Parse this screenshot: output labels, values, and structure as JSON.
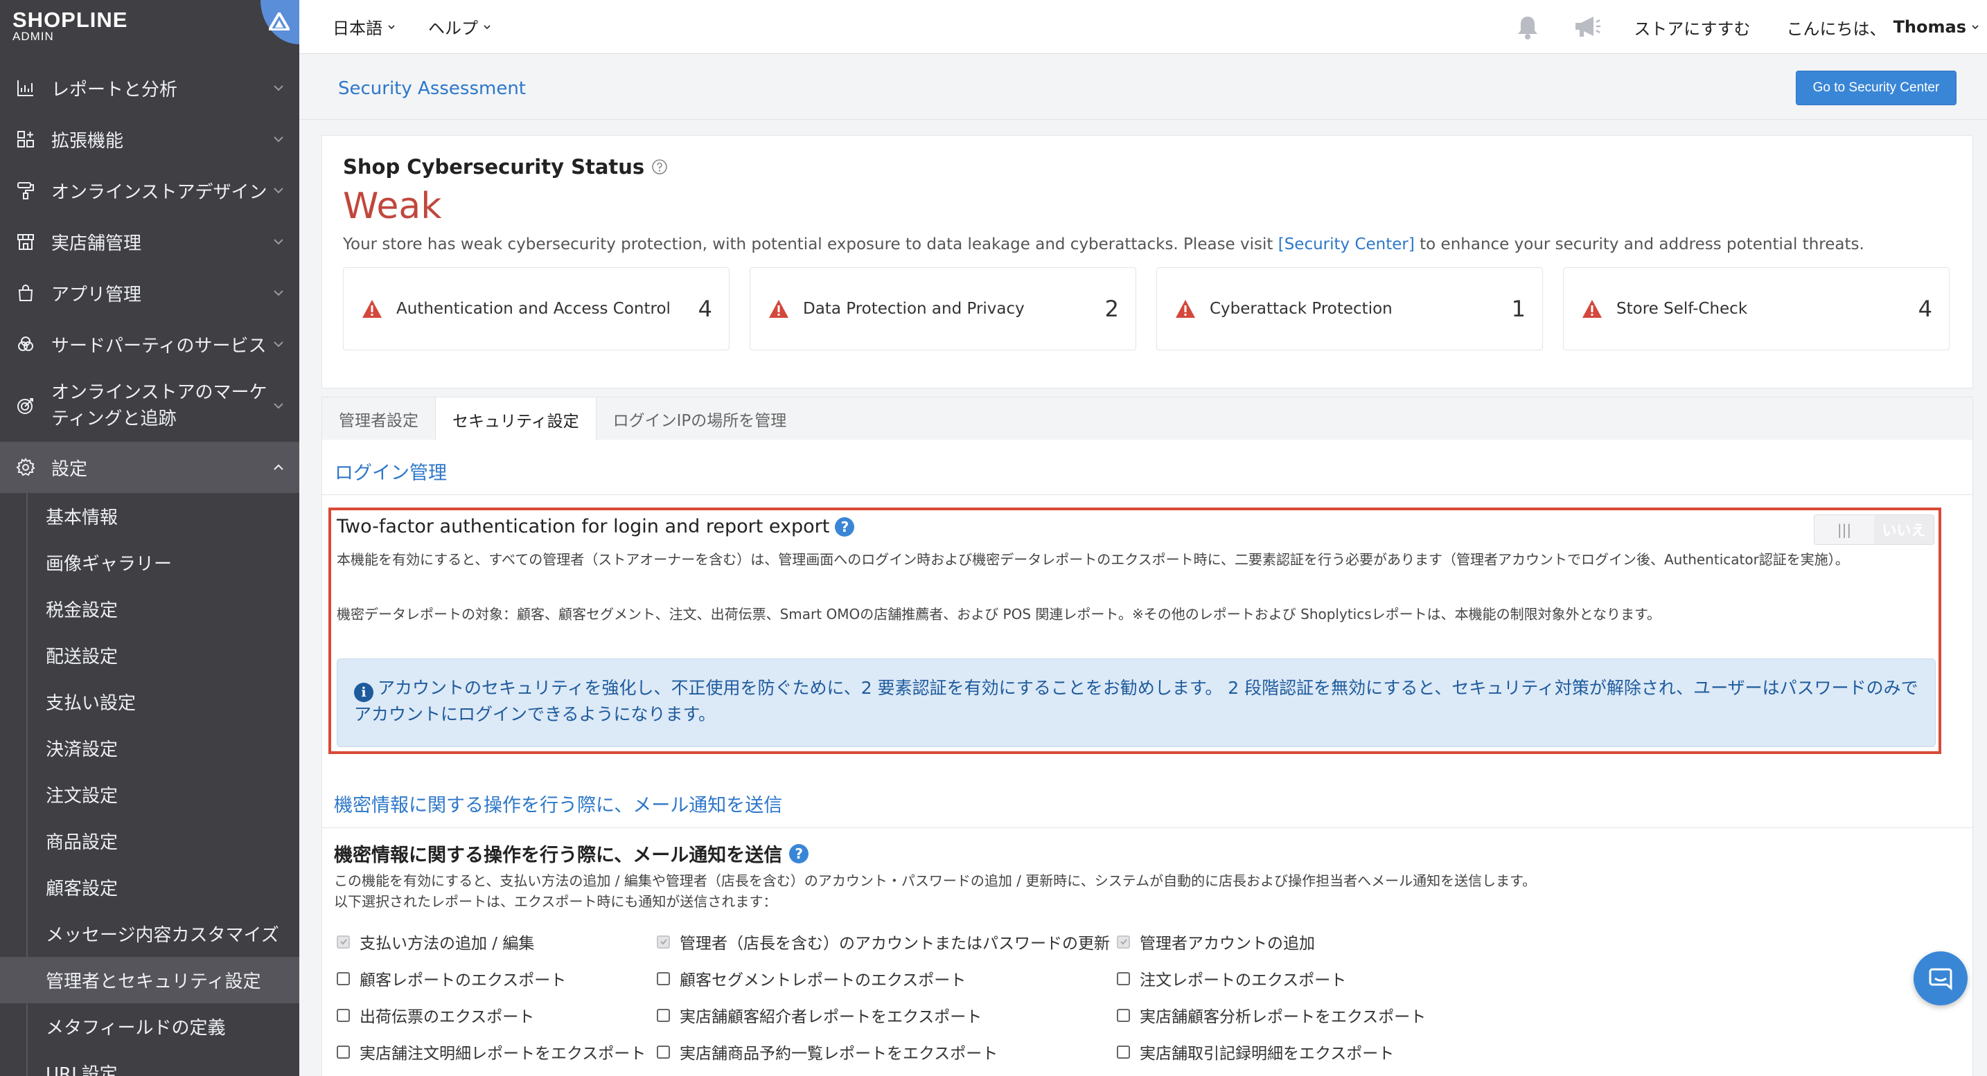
{
  "brand": {
    "name": "SHOPLINE",
    "sub": "ADMIN"
  },
  "sidebar": {
    "items": [
      {
        "label": "レポートと分析",
        "icon": "chart-icon"
      },
      {
        "label": "拡張機能",
        "icon": "grid-plus-icon"
      },
      {
        "label": "オンラインストアデザイン",
        "icon": "paint-roller-icon"
      },
      {
        "label": "実店舗管理",
        "icon": "store-icon"
      },
      {
        "label": "アプリ管理",
        "icon": "bag-icon"
      },
      {
        "label": "サードパーティのサービス",
        "icon": "circles-icon"
      },
      {
        "label": "オンラインストアのマーケティングと追跡",
        "line1": "オンラインストアのマーケ",
        "line2": "ティングと追跡",
        "icon": "target-icon"
      },
      {
        "label": "設定",
        "icon": "gear-icon"
      }
    ],
    "settings_sub": [
      "基本情報",
      "画像ギャラリー",
      "税金設定",
      "配送設定",
      "支払い設定",
      "決済設定",
      "注文設定",
      "商品設定",
      "顧客設定",
      "メッセージ内容カスタマイズ",
      "管理者とセキュリティ設定",
      "メタフィールドの定義",
      "URL設定"
    ],
    "current_sub": "管理者とセキュリティ設定"
  },
  "topbar": {
    "language": "日本語",
    "help": "ヘルプ",
    "store_link": "ストアにすすむ",
    "greeting": "こんにちは、",
    "user": "Thomas"
  },
  "page": {
    "title": "Security Assessment",
    "security_center_button": "Go to Security Center"
  },
  "status": {
    "title": "Shop Cybersecurity Status",
    "level": "Weak",
    "desc_prefix": "Your store has weak cybersecurity protection, with potential exposure to data leakage and cyberattacks. Please visit ",
    "desc_link": "[Security Center]",
    "desc_suffix": " to enhance your security and address potential threats.",
    "risks": [
      {
        "label": "Authentication and Access Control",
        "count": "4"
      },
      {
        "label": "Data Protection and Privacy",
        "count": "2"
      },
      {
        "label": "Cyberattack Protection",
        "count": "1"
      },
      {
        "label": "Store Self-Check",
        "count": "4"
      }
    ]
  },
  "tabs": [
    {
      "label": "管理者設定",
      "active": false
    },
    {
      "label": "セキュリティ設定",
      "active": true
    },
    {
      "label": "ログインIPの場所を管理",
      "active": false
    }
  ],
  "login_section": {
    "title": "ログイン管理"
  },
  "tfa": {
    "title": "Two-factor authentication for login and report export",
    "desc1": "本機能を有効にすると、すべての管理者（ストアオーナーを含む）は、管理画面へのログイン時および機密データレポートのエクスポート時に、二要素認証を行う必要があります（管理者アカウントでログイン後、Authenticator認証を実施）。",
    "desc2": "機密データレポートの対象：顧客、顧客セグメント、注文、出荷伝票、Smart OMOの店舗推薦者、および POS 関連レポート。※その他のレポートおよび Shoplyticsレポートは、本機能の制限対象外となります。",
    "toggle_on_glyph": "|||",
    "toggle_off_label": "いいえ",
    "toggle_state": "off",
    "info": "アカウントのセキュリティを強化し、不正使用を防ぐために、2 要素認証を有効にすることをお勧めします。 2 段階認証を無効にすると、セキュリティ対策が解除され、ユーザーはパスワードのみでアカウントにログインできるようになります。"
  },
  "mail_section": {
    "heading": "機密情報に関する操作を行う際に、メール通知を送信",
    "title": "機密情報に関する操作を行う際に、メール通知を送信",
    "desc1": "この機能を有効にすると、支払い方法の追加 / 編集や管理者（店長を含む）のアカウント・パスワードの追加 / 更新時に、システムが自動的に店長および操作担当者へメール通知を送信します。",
    "desc2": "以下選択されたレポートは、エクスポート時にも通知が送信されます：",
    "options": [
      {
        "label": "支払い方法の追加 / 編集",
        "checked": true
      },
      {
        "label": "管理者（店長を含む）のアカウントまたはパスワードの更新",
        "checked": true
      },
      {
        "label": "管理者アカウントの追加",
        "checked": true
      },
      {
        "label": "顧客レポートのエクスポート",
        "checked": false
      },
      {
        "label": "顧客セグメントレポートのエクスポート",
        "checked": false
      },
      {
        "label": "注文レポートのエクスポート",
        "checked": false
      },
      {
        "label": "出荷伝票のエクスポート",
        "checked": false
      },
      {
        "label": "実店舗顧客紹介者レポートをエクスポート",
        "checked": false
      },
      {
        "label": "実店舗顧客分析レポートをエクスポート",
        "checked": false
      },
      {
        "label": "実店舗注文明細レポートをエクスポート",
        "checked": false
      },
      {
        "label": "実店舗商品予約一覧レポートをエクスポート",
        "checked": false
      },
      {
        "label": "実店舗取引記録明細をエクスポート",
        "checked": false
      }
    ]
  },
  "colors": {
    "sidebar": "#3f3f44",
    "accent": "#3a86d6",
    "link": "#2d77c9",
    "weak": "#c0473c",
    "highlight_border": "#d94a37",
    "info_bg": "#dce9f6"
  }
}
